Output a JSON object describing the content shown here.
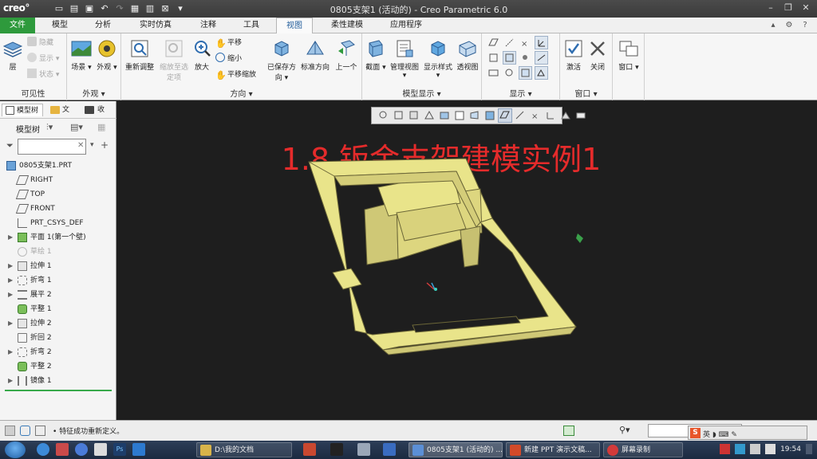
{
  "titlebar": {
    "logo": "creo°",
    "title": "0805支架1 (活动的) - Creo Parametric 6.0"
  },
  "tabs": [
    {
      "label": "文件"
    },
    {
      "label": "模型"
    },
    {
      "label": "分析"
    },
    {
      "label": "实时仿真"
    },
    {
      "label": "注释"
    },
    {
      "label": "工具"
    },
    {
      "label": "视图"
    },
    {
      "label": "柔性建模"
    },
    {
      "label": "应用程序"
    }
  ],
  "ribbon": {
    "visibility": {
      "label": "可见性",
      "layer": "层",
      "hide": "隐藏",
      "show": "显示",
      "status": "状态"
    },
    "appearance": {
      "label": "外观",
      "scene": "场景",
      "appearance": "外观"
    },
    "orientation": {
      "label": "方向",
      "refit": "重新调整",
      "zoom_in_window": "缩放至选定项",
      "zoom_in": "放大",
      "pan": "平移",
      "zoom_out": "缩小",
      "pan_zoom": "平移缩放",
      "saved_orientations": "已保存方向",
      "standard_orientation": "标准方向",
      "previous": "上一个"
    },
    "model_display": {
      "label": "模型显示",
      "section": "截面",
      "manage_views": "管理视图",
      "display_style": "显示样式",
      "perspective": "透视图"
    },
    "show": {
      "label": "显示"
    },
    "window": {
      "label": "窗口",
      "activate": "激活",
      "close": "关闭",
      "windows": "窗口"
    }
  },
  "panel": {
    "tabs": [
      "模型树",
      "文",
      "收"
    ],
    "tree_label": "模型树",
    "filter_placeholder": "",
    "tree": [
      {
        "label": "0805支架1.PRT",
        "icon": "part-icon",
        "expand": "",
        "dim": false
      },
      {
        "label": "RIGHT",
        "icon": "datum-plane-icon",
        "expand": "",
        "dim": false
      },
      {
        "label": "TOP",
        "icon": "datum-plane-icon",
        "expand": "",
        "dim": false
      },
      {
        "label": "FRONT",
        "icon": "datum-plane-icon",
        "expand": "",
        "dim": false
      },
      {
        "label": "PRT_CSYS_DEF",
        "icon": "csys-icon",
        "expand": "",
        "dim": false
      },
      {
        "label": "平面 1(第一个壁)",
        "icon": "flat-wall-icon",
        "expand": "▶",
        "dim": false
      },
      {
        "label": "草绘 1",
        "icon": "sketch-icon",
        "expand": "",
        "dim": true
      },
      {
        "label": "拉伸 1",
        "icon": "extrude-icon",
        "expand": "▶",
        "dim": false
      },
      {
        "label": "折弯 1",
        "icon": "bend-icon",
        "expand": "▶",
        "dim": false
      },
      {
        "label": "展平 2",
        "icon": "unbend-icon",
        "expand": "▶",
        "dim": false
      },
      {
        "label": "平整 1",
        "icon": "flat-icon",
        "expand": "",
        "dim": false
      },
      {
        "label": "拉伸 2",
        "icon": "extrude-icon",
        "expand": "▶",
        "dim": false
      },
      {
        "label": "折回 2",
        "icon": "bendback-icon",
        "expand": "",
        "dim": false
      },
      {
        "label": "折弯 2",
        "icon": "bend-icon",
        "expand": "▶",
        "dim": false
      },
      {
        "label": "平整 2",
        "icon": "flat-icon",
        "expand": "",
        "dim": false
      },
      {
        "label": "镜像 1",
        "icon": "mirror-icon",
        "expand": "▶",
        "dim": false
      }
    ]
  },
  "graphics": {
    "overlay_title": "1.8 钣金支架建模实例1",
    "model_color": "#e9e48a"
  },
  "message": {
    "text": "• 特征成功重新定义。"
  },
  "taskbar": {
    "buttons": [
      {
        "label": "D:\\我的文档",
        "color": "#d8b44a"
      },
      {
        "label": "0805支架1 (活动的) ...",
        "color": "#5b8fd6"
      },
      {
        "label": "新建 PPT 演示文稿...",
        "color": "#d24a2a"
      },
      {
        "label": "屏幕录制",
        "color": "#d23a3a"
      }
    ],
    "time": "19:54"
  }
}
